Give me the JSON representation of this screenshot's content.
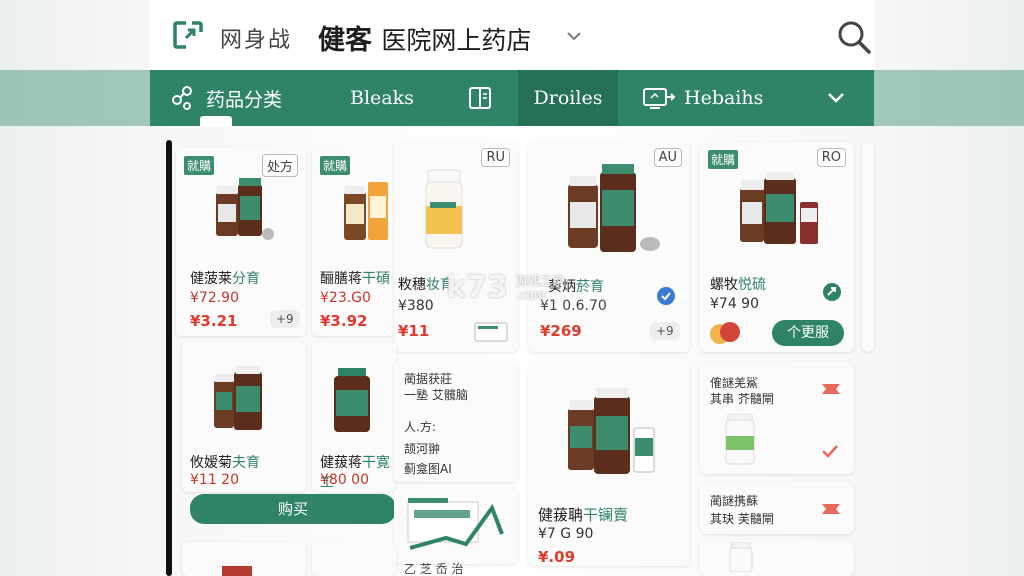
{
  "colors": {
    "accent": "#2f8465",
    "price": "#e03b2c",
    "tag": "#3b8d6e"
  },
  "header": {
    "brand": "网身战",
    "title_main": "健客",
    "title_sub": "医院网上药店",
    "icons": [
      "logo-icon",
      "chevron-down-icon",
      "search-icon"
    ]
  },
  "nav": {
    "items": [
      {
        "label": "药品分类",
        "icon": "category-icon"
      },
      {
        "label": "Bleaks",
        "icon": ""
      },
      {
        "label": "",
        "icon": "book-icon"
      },
      {
        "label": "Droiles",
        "icon": "",
        "active": true
      },
      {
        "label": "Hebaihs",
        "icon": "monitor-arrow-icon"
      }
    ],
    "more_icon": "chevron-down-icon"
  },
  "watermark": {
    "main": "k73",
    "sub": "游戏之家\n.com"
  },
  "cards": {
    "c1": {
      "tag_left": "就購",
      "tag_right": "处方",
      "name": "健菠莱",
      "name_green": "分育",
      "price1": "¥72.90",
      "price2": "¥3.21",
      "qty": "+9"
    },
    "c2": {
      "tag_left": "就購",
      "name": "酾膳蒋",
      "name_green": "干碩",
      "price1": "¥23.G0",
      "price2": "¥3.92"
    },
    "c3": {
      "tag_right": "RU",
      "name": "敉穗",
      "name_green": "妆育",
      "price1": "¥380",
      "price2": "¥11"
    },
    "c4": {
      "tag_right": "AU",
      "name": "葵炳",
      "name_green": "菸育",
      "price1": "¥1 0.6.70",
      "price2": "¥269",
      "qty": "+9"
    },
    "c5": {
      "tag_left": "就購",
      "tag_right": "RO",
      "name": "螺牧",
      "name_green": "悦硫",
      "price1": "¥74 90",
      "button": "个更服"
    },
    "c6": {
      "name": "攸嫒菊",
      "name_green": "夫育",
      "price1": "¥11 20",
      "button": "购买"
    },
    "c7": {
      "name": "健菝蒋",
      "name_green": "干寛工",
      "price1": "¥80 00"
    },
    "c8": {
      "lines": [
        "蔺据获莊",
        "一塾 艾髖脑",
        "人.方:",
        "颉河翀",
        "蓟龛图AI"
      ]
    },
    "c9": {
      "name": "健菝聃",
      "name_green": "干镧賣",
      "price1": "¥7 G 90",
      "price2": "¥.09"
    },
    "c10": {
      "lines": [
        "傕謎羌鯊",
        "其串  芥髓閘"
      ]
    },
    "c11": {
      "lines": [
        "蔺謎携蘇",
        "其玦  芙髓閘"
      ]
    },
    "c12": {
      "bottom_text": "乙 芝 岙 治"
    }
  }
}
